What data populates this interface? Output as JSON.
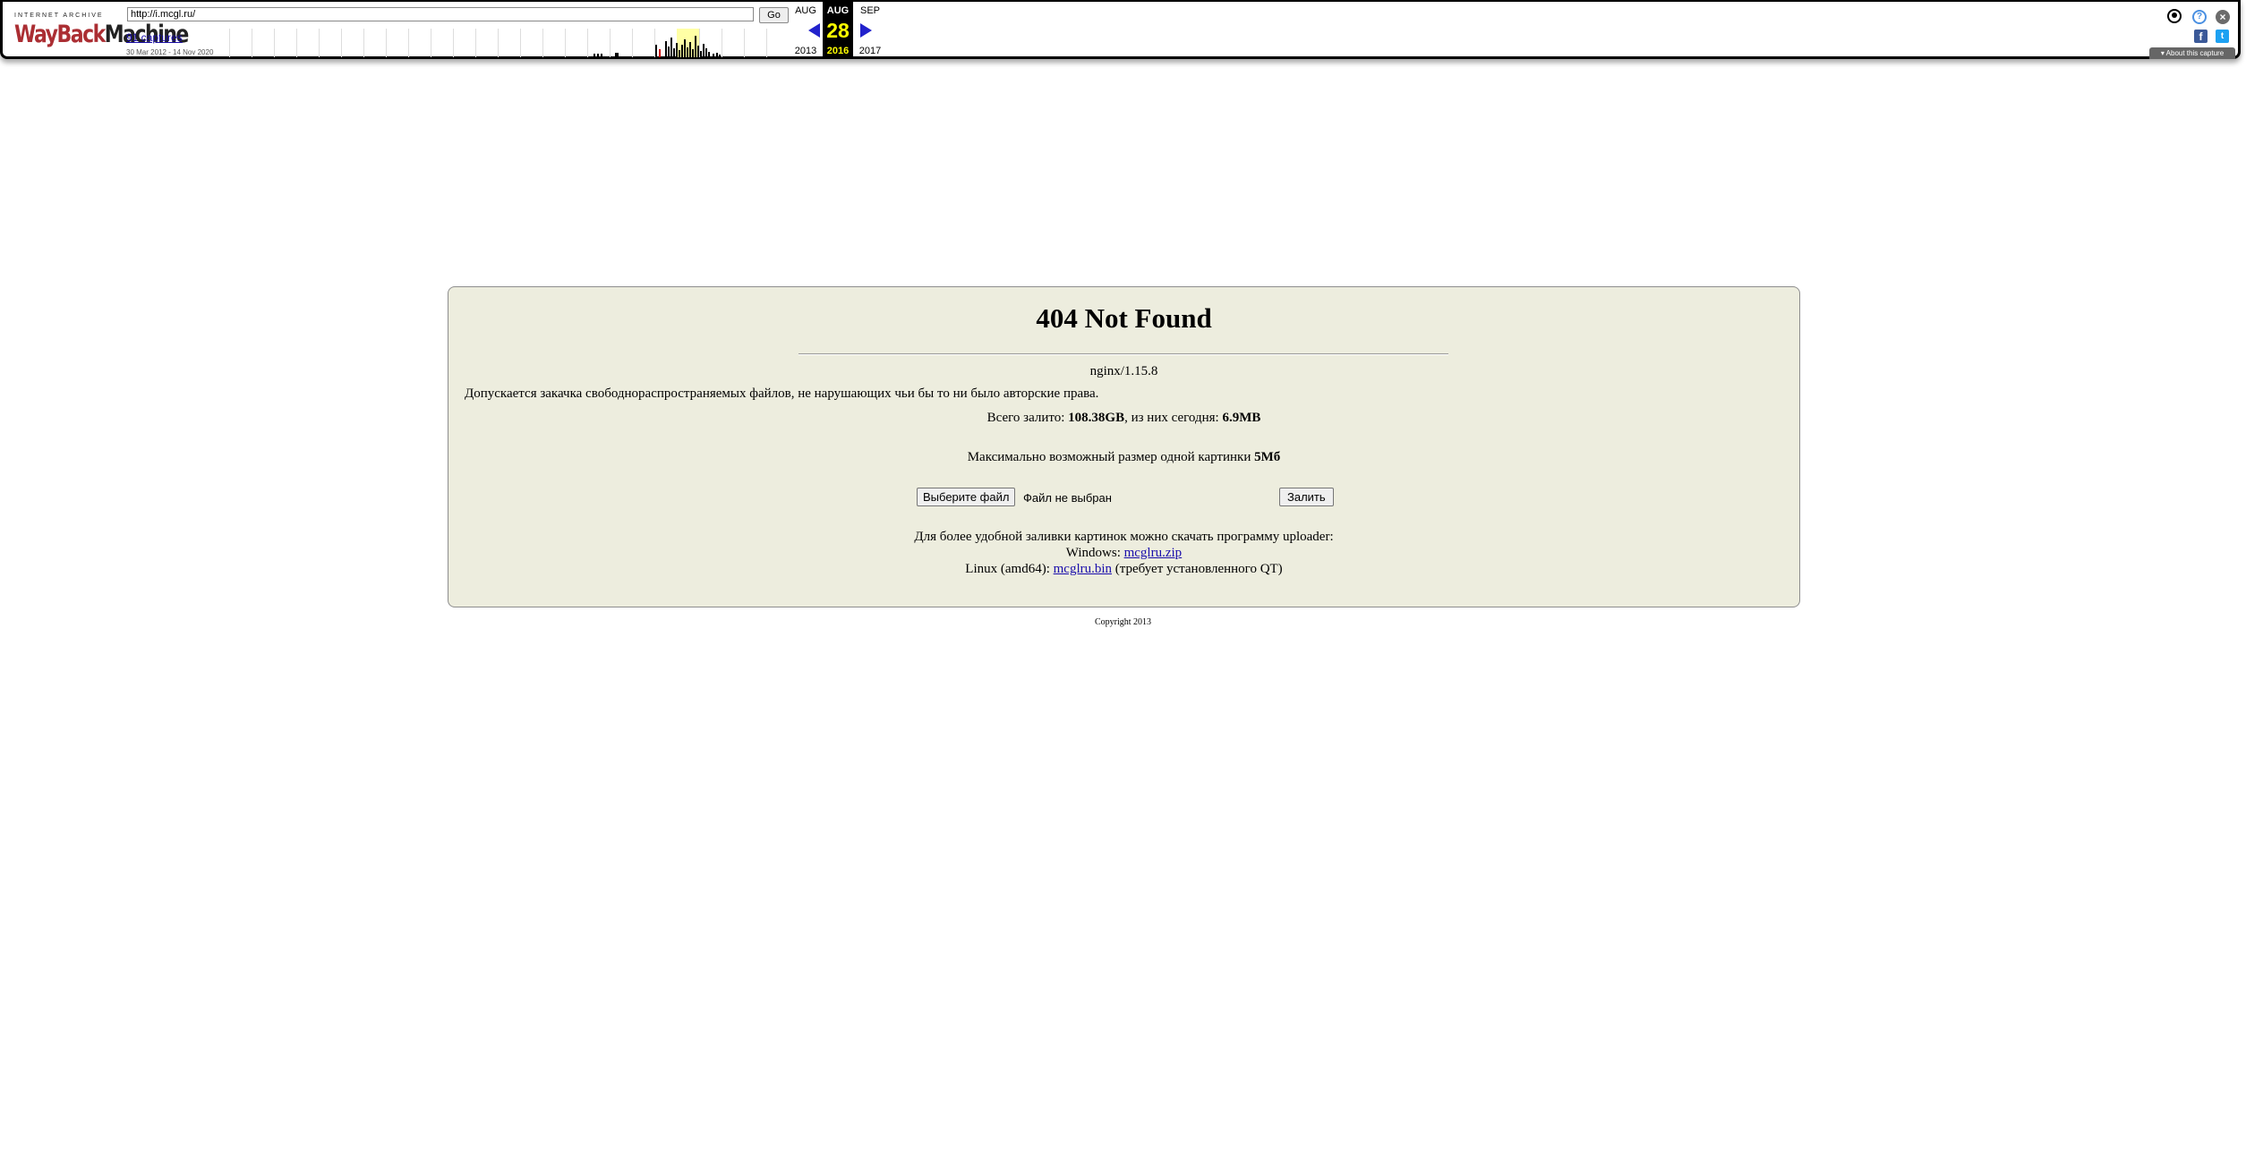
{
  "toolbar": {
    "logo_top": "INTERNET ARCHIVE",
    "logo_way": "WayBack",
    "logo_machine": "Machine",
    "url_value": "http://i.mcgl.ru/",
    "go_label": "Go",
    "captures_link": "91 captures",
    "date_range": "30 Mar 2012 - 14 Nov 2020",
    "calendar": {
      "prev_month": "AUG",
      "prev_year": "2013",
      "cur_month": "AUG",
      "cur_day": "28",
      "cur_year": "2016",
      "next_month": "SEP",
      "next_year": "2017"
    },
    "about_capture": "About this capture",
    "icons": [
      "user-icon",
      "help-icon",
      "close-icon",
      "facebook-icon",
      "twitter-icon",
      "prev-arrow-icon",
      "next-arrow-icon"
    ]
  },
  "page": {
    "title": "404 Not Found",
    "server": "nginx/1.15.8",
    "notice": "Допускается закачка свободнораспространяемых файлов, не нарушающих чьи бы то ни было авторские права.",
    "totals_prefix": "Всего залито: ",
    "totals_value": "108.38GB",
    "totals_mid": ", из них сегодня: ",
    "totals_today": "6.9MB",
    "maxsize_prefix": "Максимально возможный размер одной картинки ",
    "maxsize_value": "5Мб",
    "choose_file_label": "Выберите файл",
    "no_file_text": "Файл не выбран",
    "upload_label": "Залить",
    "dl_intro": "Для более удобной заливки картинок можно скачать программу uploader:",
    "dl_win_prefix": "Windows: ",
    "dl_win_link": "mcglru.zip",
    "dl_linux_prefix": "Linux (amd64): ",
    "dl_linux_link": "mcglru.bin",
    "dl_linux_suffix": " (требует установленного QT)",
    "copyright": "Copyright 2013"
  },
  "colors": {
    "panel_bg": "#ededde",
    "link": "#1a0dab",
    "calendar_highlight": "#ffff00",
    "arrow": "#2222cc",
    "logo_red": "#ab2e33"
  }
}
